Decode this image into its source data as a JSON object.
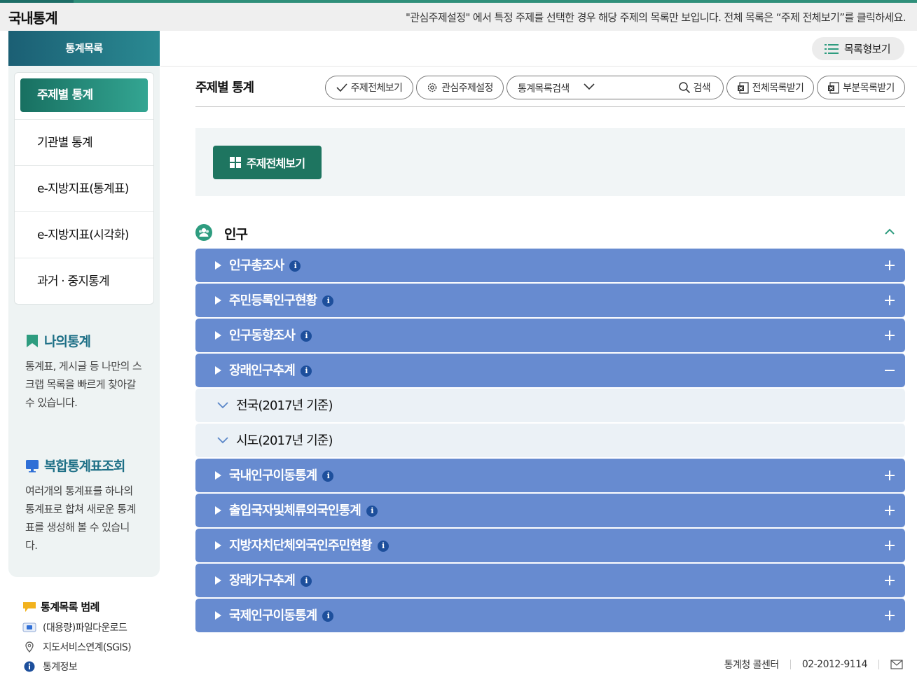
{
  "app": {
    "title": "국내통계",
    "notice": "\"관심주제설정\" 에서 특정 주제를 선택한 경우 해당 주제의 목록만 보입니다. 전체 목록은 “주제 전체보기”를 클릭하세요."
  },
  "sidebar": {
    "header": "통계목록",
    "items": [
      {
        "label": "주제별 통계",
        "active": true
      },
      {
        "label": "기관별 통계",
        "active": false
      },
      {
        "label": "e-지방지표(통계표)",
        "active": false
      },
      {
        "label": "e-지방지표(시각화)",
        "active": false
      },
      {
        "label": "과거 · 중지통계",
        "active": false
      }
    ],
    "promos": [
      {
        "title": "나의통계",
        "desc": "통계표, 게시글 등 나만의 스크랩 목록을 빠르게 찾아갈 수 있습니다.",
        "icon": "bookmark-icon",
        "color": "#2e9c7f"
      },
      {
        "title": "복합통계표조회",
        "desc": "여러개의 통계표를 하나의 통계표로 합쳐 새로운 통계표를 생성해 볼 수 있습니다.",
        "icon": "monitor-icon",
        "color": "#2f6fd6"
      }
    ],
    "legend": {
      "title": "통계목록 범례",
      "items": [
        {
          "label": "(대용량)파일다운로드",
          "icon": "download-file-icon"
        },
        {
          "label": "지도서비스연계(SGIS)",
          "icon": "map-pin-icon"
        },
        {
          "label": "통계정보",
          "icon": "info-icon"
        }
      ]
    }
  },
  "topbar": {
    "list_view_label": "목록형보기"
  },
  "toolbar": {
    "title": "주제별 통계",
    "all_topics_label": "주제전체보기",
    "interest_label": "관심주제설정",
    "search_select": "통계목록검색",
    "search_value": "",
    "search_button": "검색",
    "download_all_label": "전체목록받기",
    "download_part_label": "부분목록받기"
  },
  "all_button_label": "주제전체보기",
  "section": {
    "title": "인구",
    "rows": [
      {
        "label": "인구총조사",
        "type": "category",
        "expanded": false,
        "info": true
      },
      {
        "label": "주민등록인구현황",
        "type": "category",
        "expanded": false,
        "info": true
      },
      {
        "label": "인구동향조사",
        "type": "category",
        "expanded": false,
        "info": true
      },
      {
        "label": "장래인구추계",
        "type": "category",
        "expanded": true,
        "info": true
      },
      {
        "label": "전국(2017년 기준)",
        "type": "sub"
      },
      {
        "label": "시도(2017년 기준)",
        "type": "sub"
      },
      {
        "label": "국내인구이동통계",
        "type": "category",
        "expanded": false,
        "info": true
      },
      {
        "label": "출입국자및체류외국인통계",
        "type": "category",
        "expanded": false,
        "info": true
      },
      {
        "label": "지방자치단체외국인주민현황",
        "type": "category",
        "expanded": false,
        "info": true
      },
      {
        "label": "장래가구추계",
        "type": "category",
        "expanded": false,
        "info": true
      },
      {
        "label": "국제인구이동통계",
        "type": "category",
        "expanded": false,
        "info": true
      }
    ]
  },
  "footer": {
    "callcenter": "통계청 콜센터",
    "phone": "02-2012-9114"
  },
  "colors": {
    "brand": "#1e7560",
    "category_row": "#678bd0",
    "sub_row": "#ebf1f6"
  }
}
